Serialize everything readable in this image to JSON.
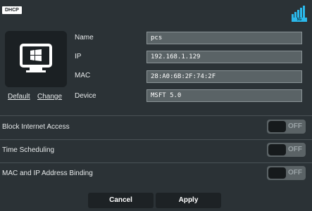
{
  "header": {
    "badge": "DHCP",
    "band_label": "5G"
  },
  "device": {
    "icon": "windows-monitor-icon",
    "default_link": "Default",
    "change_link": "Change"
  },
  "fields": [
    {
      "label": "Name",
      "value": "pcs"
    },
    {
      "label": "IP",
      "value": "192.168.1.129"
    },
    {
      "label": "MAC",
      "value": "28:A0:6B:2F:74:2F"
    },
    {
      "label": "Device",
      "value": "MSFT 5.0"
    }
  ],
  "settings": [
    {
      "label": "Block Internet Access",
      "state": "OFF"
    },
    {
      "label": "Time Scheduling",
      "state": "OFF"
    },
    {
      "label": "MAC and IP Address Binding",
      "state": "OFF"
    }
  ],
  "actions": {
    "cancel": "Cancel",
    "apply": "Apply"
  },
  "colors": {
    "accent": "#2bb8ea",
    "background": "#2b3236",
    "button": "#1d2225"
  }
}
